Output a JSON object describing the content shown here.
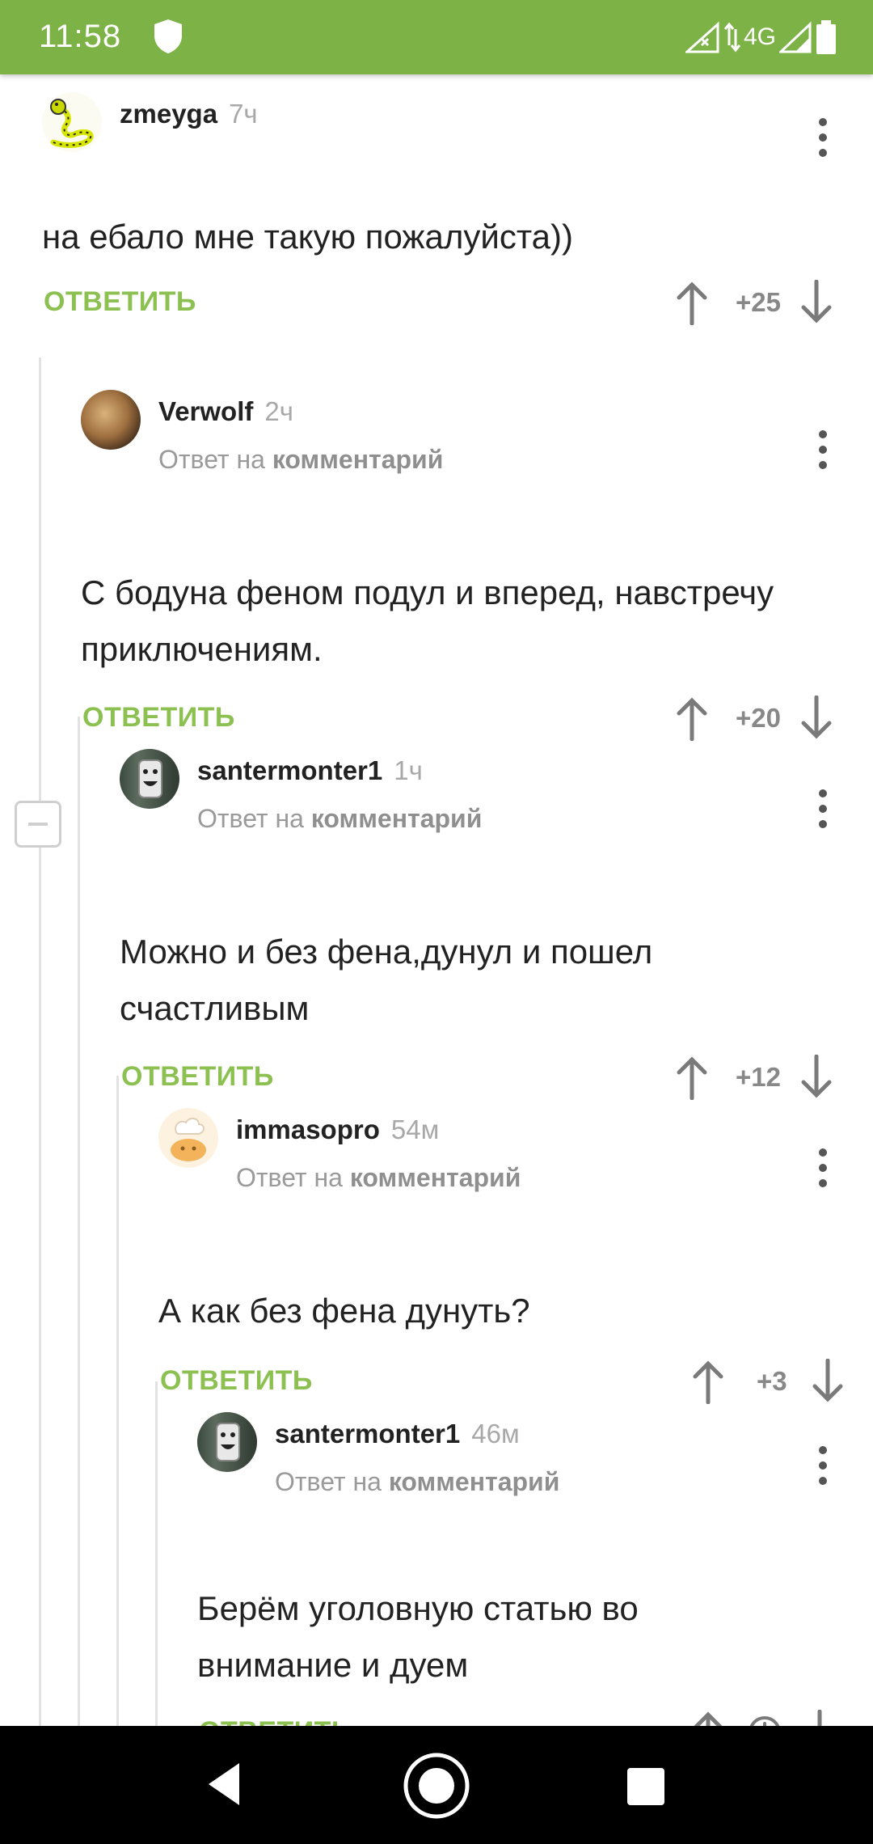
{
  "status_bar": {
    "time": "11:58",
    "network": "4G",
    "icons": [
      "shield-icon",
      "signal-icon",
      "wifi-icon",
      "battery-icon"
    ]
  },
  "colors": {
    "accent": "#8cc152",
    "status_bar": "#7db346",
    "thread_line": "#e2e2e2"
  },
  "comments": [
    {
      "author": "zmeyga",
      "age": "7ч",
      "reply_to_prefix": "",
      "reply_to_link": "",
      "text": "на ебало мне такую пожалуйста))",
      "reply_label": "ОТВЕТИТЬ",
      "rating": "+25",
      "avatar": "snake-avatar"
    },
    {
      "author": "Verwolf",
      "age": "2ч",
      "reply_to_prefix": "Ответ на",
      "reply_to_link": "комментарий",
      "text": "С бодуна феном подул и вперед, навстречу приключениям.",
      "reply_label": "ОТВЕТИТЬ",
      "rating": "+20",
      "avatar": "photo-avatar"
    },
    {
      "author": "santermonter1",
      "age": "1ч",
      "reply_to_prefix": "Ответ на",
      "reply_to_link": "комментарий",
      "text": "Можно и без фена,дунул и пошел счастливым",
      "reply_label": "ОТВЕТИТЬ",
      "rating": "+12",
      "avatar": "smiley-avatar"
    },
    {
      "author": "immasopro",
      "age": "54м",
      "reply_to_prefix": "Ответ на",
      "reply_to_link": "комментарий",
      "text": "А как без фена дунуть?",
      "reply_label": "ОТВЕТИТЬ",
      "rating": "+3",
      "avatar": "chef-avatar"
    },
    {
      "author": "santermonter1",
      "age": "46м",
      "reply_to_prefix": "Ответ на",
      "reply_to_link": "комментарий",
      "text": "Берём уголовную статью во внимание и дуем",
      "reply_label": "ОТВЕТИТЬ",
      "rating": "",
      "avatar": "smiley-avatar",
      "rating_icon": "clock-icon"
    }
  ],
  "nav_bar": {
    "icons": [
      "back-icon",
      "home-icon",
      "recents-icon"
    ]
  }
}
